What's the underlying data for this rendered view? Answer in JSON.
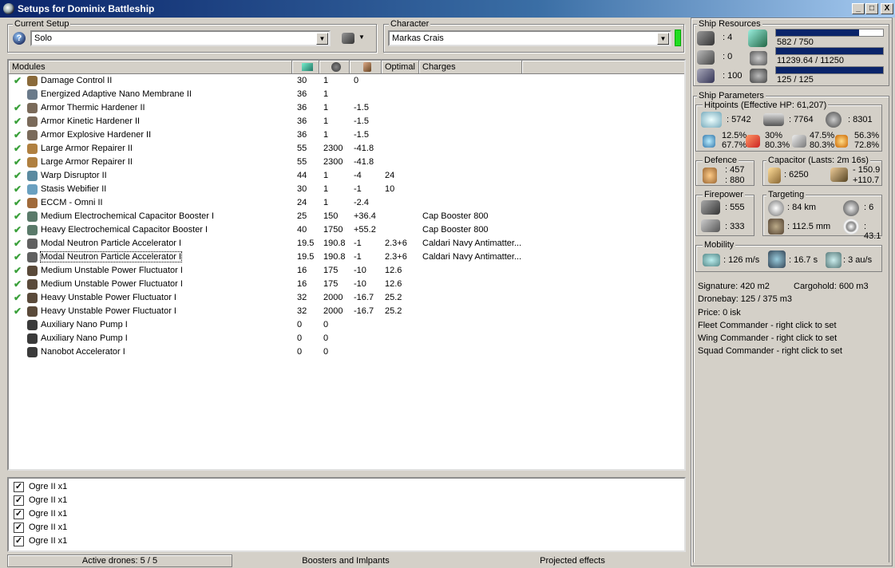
{
  "window": {
    "title": "Setups for Dominix Battleship",
    "min": "_",
    "max": "□",
    "close": "X"
  },
  "setup": {
    "label": "Current Setup",
    "value": "Solo"
  },
  "character": {
    "label": "Character",
    "value": "Markas Crais"
  },
  "modules": {
    "headers": [
      "Modules",
      "",
      "",
      "",
      "Optimal",
      "Charges"
    ],
    "rows": [
      {
        "check": true,
        "name": "Damage Control II",
        "c1": "30",
        "c2": "1",
        "c3": "0",
        "opt": "",
        "charge": "",
        "color": "#8a6a3a"
      },
      {
        "check": false,
        "name": "Energized Adaptive Nano Membrane II",
        "c1": "36",
        "c2": "1",
        "c3": "",
        "opt": "",
        "charge": "",
        "color": "#6a7a8a"
      },
      {
        "check": true,
        "name": "Armor Thermic Hardener II",
        "c1": "36",
        "c2": "1",
        "c3": "-1.5",
        "opt": "",
        "charge": "",
        "color": "#7a6a5a"
      },
      {
        "check": true,
        "name": "Armor Kinetic Hardener II",
        "c1": "36",
        "c2": "1",
        "c3": "-1.5",
        "opt": "",
        "charge": "",
        "color": "#7a6a5a"
      },
      {
        "check": true,
        "name": "Armor Explosive Hardener II",
        "c1": "36",
        "c2": "1",
        "c3": "-1.5",
        "opt": "",
        "charge": "",
        "color": "#7a6a5a"
      },
      {
        "check": true,
        "name": "Large Armor Repairer II",
        "c1": "55",
        "c2": "2300",
        "c3": "-41.8",
        "opt": "",
        "charge": "",
        "color": "#b08040"
      },
      {
        "check": true,
        "name": "Large Armor Repairer II",
        "c1": "55",
        "c2": "2300",
        "c3": "-41.8",
        "opt": "",
        "charge": "",
        "color": "#b08040"
      },
      {
        "check": true,
        "name": "Warp Disruptor II",
        "c1": "44",
        "c2": "1",
        "c3": "-4",
        "opt": "24",
        "charge": "",
        "color": "#5a8aa0"
      },
      {
        "check": true,
        "name": "Stasis Webifier II",
        "c1": "30",
        "c2": "1",
        "c3": "-1",
        "opt": "10",
        "charge": "",
        "color": "#6aa0c0"
      },
      {
        "check": true,
        "name": "ECCM - Omni II",
        "c1": "24",
        "c2": "1",
        "c3": "-2.4",
        "opt": "",
        "charge": "",
        "color": "#a06a3a"
      },
      {
        "check": true,
        "name": "Medium Electrochemical Capacitor Booster I",
        "c1": "25",
        "c2": "150",
        "c3": "+36.4",
        "opt": "",
        "charge": "Cap Booster 800",
        "color": "#5a7a6a"
      },
      {
        "check": true,
        "name": "Heavy Electrochemical Capacitor Booster I",
        "c1": "40",
        "c2": "1750",
        "c3": "+55.2",
        "opt": "",
        "charge": "Cap Booster 800",
        "color": "#5a7a6a"
      },
      {
        "check": true,
        "name": "Modal Neutron Particle Accelerator I",
        "c1": "19.5",
        "c2": "190.8",
        "c3": "-1",
        "opt": "2.3+6",
        "charge": "Caldari Navy Antimatter...",
        "color": "#606060"
      },
      {
        "check": true,
        "name": "Modal Neutron Particle Accelerator I",
        "c1": "19.5",
        "c2": "190.8",
        "c3": "-1",
        "opt": "2.3+6",
        "charge": "Caldari Navy Antimatter...",
        "color": "#606060"
      },
      {
        "check": true,
        "name": "Medium Unstable Power Fluctuator I",
        "c1": "16",
        "c2": "175",
        "c3": "-10",
        "opt": "12.6",
        "charge": "",
        "color": "#5a4a3a"
      },
      {
        "check": true,
        "name": "Medium Unstable Power Fluctuator I",
        "c1": "16",
        "c2": "175",
        "c3": "-10",
        "opt": "12.6",
        "charge": "",
        "color": "#5a4a3a"
      },
      {
        "check": true,
        "name": "Heavy Unstable Power Fluctuator I",
        "c1": "32",
        "c2": "2000",
        "c3": "-16.7",
        "opt": "25.2",
        "charge": "",
        "color": "#5a4a3a"
      },
      {
        "check": true,
        "name": "Heavy Unstable Power Fluctuator I",
        "c1": "32",
        "c2": "2000",
        "c3": "-16.7",
        "opt": "25.2",
        "charge": "",
        "color": "#5a4a3a"
      },
      {
        "check": false,
        "name": "Auxiliary Nano Pump I",
        "c1": "0",
        "c2": "0",
        "c3": "",
        "opt": "",
        "charge": "",
        "color": "#3a3a3a"
      },
      {
        "check": false,
        "name": "Auxiliary Nano Pump I",
        "c1": "0",
        "c2": "0",
        "c3": "",
        "opt": "",
        "charge": "",
        "color": "#3a3a3a"
      },
      {
        "check": false,
        "name": "Nanobot Accelerator I",
        "c1": "0",
        "c2": "0",
        "c3": "",
        "opt": "",
        "charge": "",
        "color": "#3a3a3a"
      }
    ]
  },
  "drones": [
    "Ogre II x1",
    "Ogre II x1",
    "Ogre II x1",
    "Ogre II x1",
    "Ogre II x1"
  ],
  "tabs": {
    "drones": "Active drones: 5 / 5",
    "boosters": "Boosters and Imlpants",
    "projected": "Projected effects"
  },
  "resources": {
    "label": "Ship Resources",
    "turret": ": 4",
    "launcher": ": 0",
    "calib": ": 100",
    "cpu_text": "582 / 750",
    "cpu_frac": 0.776,
    "pg_text": "11239.64 / 11250",
    "pg_frac": 0.999,
    "bw_text": "125 / 125",
    "bw_frac": 1.0
  },
  "params": {
    "label": "Ship Parameters",
    "hp_label": "Hitpoints (Effective HP: 61,207)",
    "shield_hp": ": 5742",
    "armor_hp": ": 7764",
    "hull_hp": ": 8301",
    "res": [
      [
        "12.5%",
        "67.7%"
      ],
      [
        "30%",
        "80.3%"
      ],
      [
        "47.5%",
        "80.3%"
      ],
      [
        "56.3%",
        "72.8%"
      ]
    ],
    "defence_label": "Defence",
    "def1": ": 457",
    "def2": ": 880",
    "cap_label": "Capacitor (Lasts: 2m 16s)",
    "cap_val": ": 6250",
    "cap_use": "- 150.9",
    "cap_rech": "+110.7",
    "fire_label": "Firepower",
    "fire1": ": 555",
    "fire2": ": 333",
    "target_label": "Targeting",
    "t_range": ": 84 km",
    "t_max": ": 6",
    "t_res": ": 112.5 mm",
    "t_scan": ": 43.1",
    "mob_label": "Mobility",
    "speed": ": 126 m/s",
    "align": ": 16.7 s",
    "warp": ": 3 au/s",
    "signature": "Signature: 420 m2",
    "cargo": "Cargohold: 600 m3",
    "dronebay": "Dronebay: 125 / 375 m3",
    "price": "Price: 0 isk",
    "fleet": "Fleet Commander - right click to set",
    "wing": "Wing Commander - right click to set",
    "squad": "Squad Commander - right click to set"
  }
}
